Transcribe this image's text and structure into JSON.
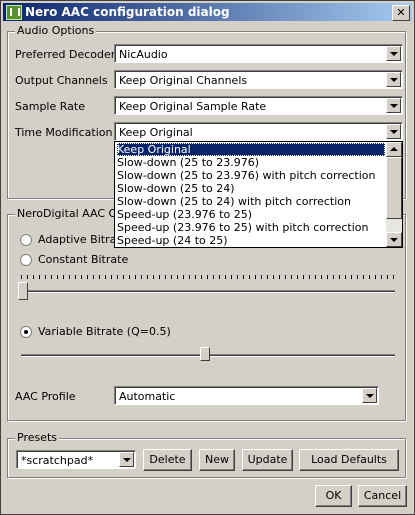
{
  "window": {
    "title": "Nero AAC configuration dialog",
    "close_glyph": "✕"
  },
  "audio": {
    "legend": "Audio Options",
    "preferred_decoder": {
      "label": "Preferred Decoder",
      "value": "NicAudio"
    },
    "output_channels": {
      "label": "Output Channels",
      "value": "Keep Original Channels"
    },
    "sample_rate": {
      "label": "Sample Rate",
      "value": "Keep Original Sample Rate"
    },
    "time_modification": {
      "label": "Time Modification",
      "value": "Keep Original",
      "options": [
        "Keep Original",
        "Slow-down (25 to 23.976)",
        "Slow-down (25 to 23.976) with pitch correction",
        "Slow-down (25 to 24)",
        "Slow-down (25 to 24) with pitch correction",
        "Speed-up (23.976 to 25)",
        "Speed-up (23.976 to 25) with pitch correction",
        "Speed-up (24 to 25)"
      ],
      "selected_index": 0
    }
  },
  "nerodigital": {
    "legend": "NeroDigital AAC Op",
    "adaptive_bitrate": {
      "label": "Adaptive Bitrate",
      "checked": false
    },
    "constant_bitrate": {
      "label": "Constant Bitrate",
      "checked": false
    },
    "constant_slider_level": 0.0,
    "variable_bitrate": {
      "label": "Variable Bitrate (Q=0.5)",
      "checked": true
    },
    "variable_slider_level": 0.5,
    "aac_profile": {
      "label": "AAC Profile",
      "value": "Automatic"
    }
  },
  "presets": {
    "legend": "Presets",
    "current": "*scratchpad*",
    "delete_label": "Delete",
    "new_label": "New",
    "update_label": "Update",
    "load_defaults_label": "Load Defaults"
  },
  "footer": {
    "ok_label": "OK",
    "cancel_label": "Cancel"
  }
}
